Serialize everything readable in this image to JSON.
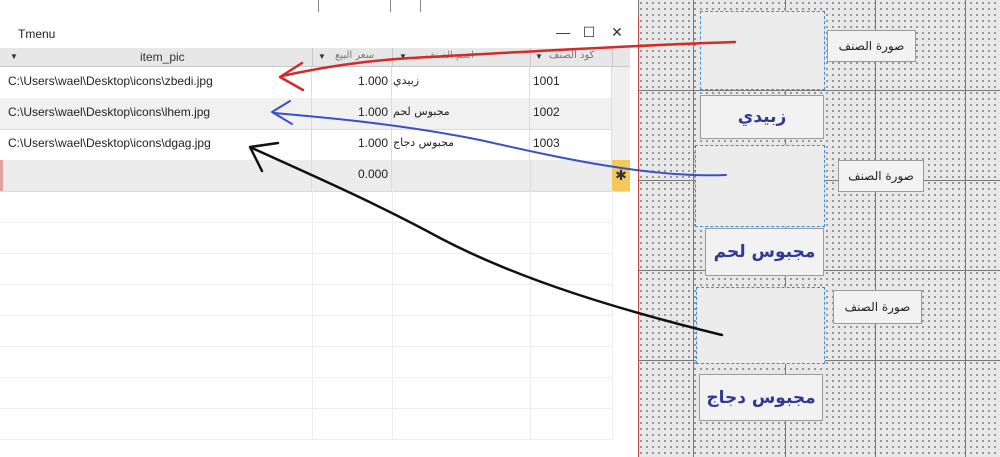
{
  "window": {
    "title": "Tmenu",
    "buttons": {
      "minimize": "—",
      "maximize": "☐",
      "close": "✕"
    }
  },
  "table": {
    "columns": [
      {
        "key": "item_pic",
        "label": "item_pic"
      },
      {
        "key": "price",
        "label": "سعر البيع"
      },
      {
        "key": "name",
        "label": "اسم الصنف"
      },
      {
        "key": "code",
        "label": "كود الصنف"
      }
    ],
    "rows": [
      {
        "item_pic": "C:\\Users\\wael\\Desktop\\icons\\zbedi.jpg",
        "price": "1.000",
        "name": "زبيدي",
        "code": "1001"
      },
      {
        "item_pic": "C:\\Users\\wael\\Desktop\\icons\\lhem.jpg",
        "price": "1.000",
        "name": "مجبوس لحم",
        "code": "1002"
      },
      {
        "item_pic": "C:\\Users\\wael\\Desktop\\icons\\dgag.jpg",
        "price": "1.000",
        "name": "مجبوس دجاج",
        "code": "1003"
      }
    ],
    "new_row": {
      "price": "0.000",
      "selector": "✱"
    }
  },
  "form": {
    "items": [
      {
        "pic_label": "صورة الصنف",
        "name": "زبيدي"
      },
      {
        "pic_label": "صورة الصنف",
        "name": "مجبوس لحم"
      },
      {
        "pic_label": "صورة الصنف",
        "name": "مجبوس دجاج"
      }
    ]
  },
  "colors": {
    "arrow_red": "#d42a2a",
    "arrow_blue": "#3b4fc8",
    "arrow_black": "#111111",
    "name_text": "#2f3a94",
    "picbox_border": "#3a8fd6",
    "new_row_selector": "#f5c85c"
  }
}
